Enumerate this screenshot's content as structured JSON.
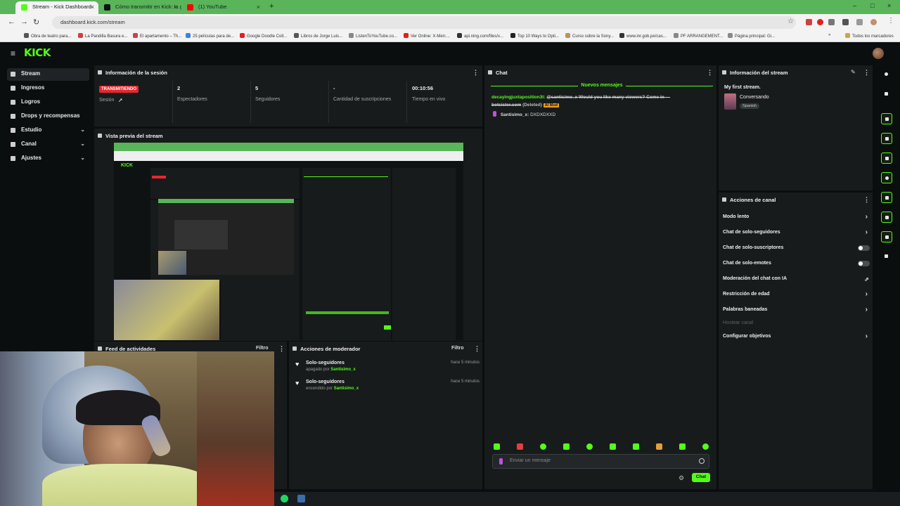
{
  "browser": {
    "tabs": [
      {
        "label": "Stream - Kick Dashboard",
        "icon_color": "#53fc18",
        "active": true
      },
      {
        "label": "Cómo transmitir en Kick: la guí",
        "icon_color": "#111111",
        "active": false
      },
      {
        "label": "(1) YouTube",
        "icon_color": "#ff0000",
        "active": false
      }
    ],
    "url": "dashboard.kick.com/stream",
    "bookmarks": [
      {
        "label": "Obra de teatro para...",
        "color": "#555555"
      },
      {
        "label": "La Pandilla Basura e...",
        "color": "#d04040"
      },
      {
        "label": "El apartamento – Th...",
        "color": "#d04040"
      },
      {
        "label": "25 películas para de...",
        "color": "#4080e0"
      },
      {
        "label": "Google Doodle Coll...",
        "color": "#e02020"
      },
      {
        "label": "Libros de Jorge Luis...",
        "color": "#555555"
      },
      {
        "label": "ListenToYouTube.co...",
        "color": "#888888"
      },
      {
        "label": "Ver Online: X-Men:...",
        "color": "#e02020"
      },
      {
        "label": "api.ning.com/files/x...",
        "color": "#333333"
      },
      {
        "label": "Top 10 Ways to Opti...",
        "color": "#222222"
      },
      {
        "label": "Curso sobre la Sony...",
        "color": "#c09060"
      },
      {
        "label": "www.inr.gob.pe/cas...",
        "color": "#333333"
      },
      {
        "label": "PF ARRANGEMENT...",
        "color": "#888888"
      },
      {
        "label": "Página principal: Gi...",
        "color": "#888888"
      }
    ],
    "bookmarks_all": "Todos los marcadores"
  },
  "app": {
    "logo": "KICK"
  },
  "sidebar": {
    "items": [
      {
        "label": "Stream",
        "expandable": false,
        "active": true
      },
      {
        "label": "Ingresos",
        "expandable": false
      },
      {
        "label": "Logros",
        "expandable": false
      },
      {
        "label": "Drops y recompensas",
        "expandable": false
      },
      {
        "label": "Estudio",
        "expandable": true
      },
      {
        "label": "Canal",
        "expandable": true
      },
      {
        "label": "Ajustes",
        "expandable": true
      }
    ]
  },
  "session": {
    "title": "Información de la sesión",
    "status_badge": "TRANSMITIENDO",
    "status_label": "Sesión",
    "viewers_value": "2",
    "viewers_label": "Espectadores",
    "followers_value": "5",
    "followers_label": "Seguidores",
    "subs_value": "-",
    "subs_label": "Cantidad de suscripciones",
    "time_value": "00:10:56",
    "time_label": "Tiempo en vivo"
  },
  "preview": {
    "title": "Vista previa del stream"
  },
  "activity": {
    "title": "Feed de actividades",
    "filter": "Filtro"
  },
  "modactions": {
    "title": "Acciones de moderador",
    "filter": "Filtro",
    "items": [
      {
        "action": "Solo-seguidores",
        "detail": "apagado por",
        "user": "Santisimo_x",
        "time": "hace 5 minutos"
      },
      {
        "action": "Solo-seguidores",
        "detail": "encendido por",
        "user": "Santisimo_x",
        "time": "hace 5 minutos"
      }
    ]
  },
  "chat": {
    "title": "Chat",
    "new_messages": "Nuevos mensajes",
    "messages": [
      {
        "user": "decayingjuxtaposition3t:",
        "text": "@santisimo_x Would you like many viewers? Come in — botsister.com",
        "status": "(Deleted)",
        "tag": "AI Mod"
      },
      {
        "user": "Santisimo_x:",
        "text": "DXDXDXXD"
      }
    ],
    "placeholder": "Enviar un mensaje",
    "send_label": "Chat",
    "accent": "#53fc18"
  },
  "stream_info": {
    "title": "Información del stream",
    "stream_title": "My first stream.",
    "category": "Conversando",
    "language": "Spanish"
  },
  "channel_actions": {
    "title": "Acciones de canal",
    "items": [
      {
        "label": "Modo lento",
        "control": "chevron"
      },
      {
        "label": "Chat de solo-seguidores",
        "control": "chevron"
      },
      {
        "label": "Chat de solo-suscriptores",
        "control": "toggle"
      },
      {
        "label": "Chat de solo-emotes",
        "control": "toggle"
      },
      {
        "label": "Moderación del chat con IA",
        "control": "external"
      },
      {
        "label": "Restricción de edad",
        "control": "chevron"
      },
      {
        "label": "Palabras baneadas",
        "control": "chevron"
      },
      {
        "label": "Hostear canal",
        "control": "none",
        "disabled": true
      },
      {
        "label": "Configurar objetivos",
        "control": "chevron"
      }
    ]
  },
  "icons": {
    "sidebar": [
      "stream-icon",
      "revenue-icon",
      "achievements-icon",
      "drops-icon",
      "studio-icon",
      "channel-icon",
      "settings-icon"
    ],
    "rail": [
      "info-icon",
      "edit-icon",
      "camera-icon",
      "lightning-icon",
      "book-icon",
      "chat-bubble-icon",
      "broadcast-icon",
      "calendar-icon",
      "wrench-icon",
      "plug-icon"
    ]
  }
}
